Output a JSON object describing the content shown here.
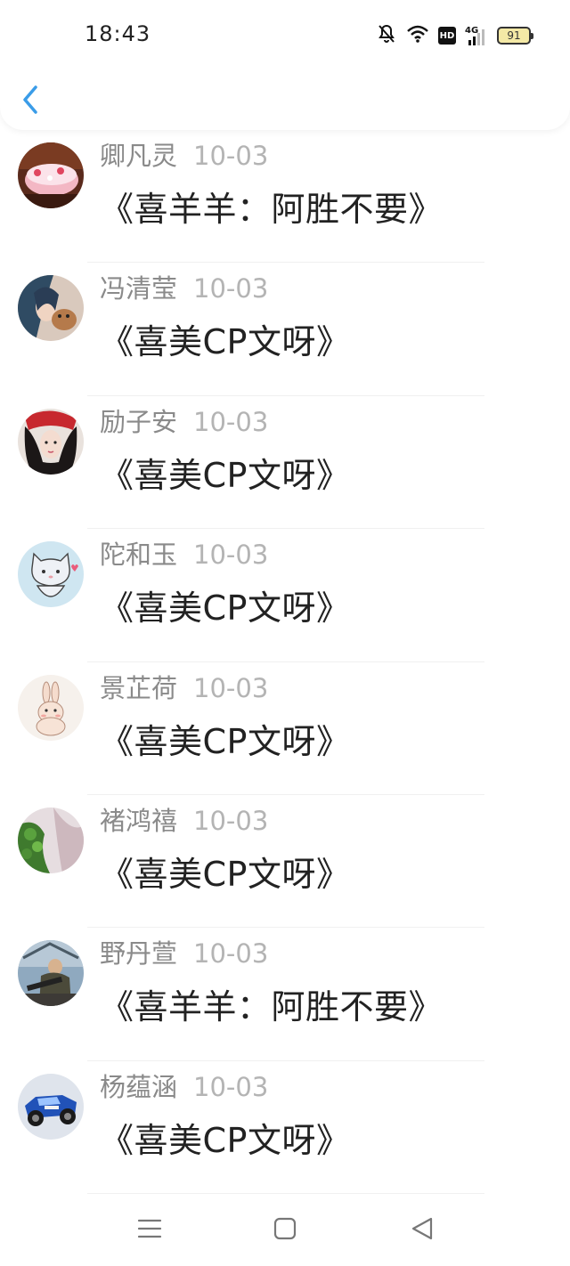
{
  "status_bar": {
    "time": "18:43",
    "battery_level": "91",
    "hd_label": "HD",
    "network_label": "4G",
    "icons": [
      "bell-muted-icon",
      "wifi-icon",
      "hd-icon",
      "signal-4g-icon",
      "battery-icon"
    ]
  },
  "header": {
    "back_icon": "chevron-left-icon",
    "accent_color": "#3a9ce8"
  },
  "comments": [
    {
      "name": "卿凡灵",
      "date": "10-03",
      "message": "《喜羊羊：阿胜不要》"
    },
    {
      "name": "冯清莹",
      "date": "10-03",
      "message": "《喜美CP文呀》"
    },
    {
      "name": "励子安",
      "date": "10-03",
      "message": "《喜美CP文呀》"
    },
    {
      "name": "陀和玉",
      "date": "10-03",
      "message": "《喜美CP文呀》"
    },
    {
      "name": "景芷荷",
      "date": "10-03",
      "message": "《喜美CP文呀》"
    },
    {
      "name": "褚鸿禧",
      "date": "10-03",
      "message": "《喜美CP文呀》"
    },
    {
      "name": "野丹萱",
      "date": "10-03",
      "message": "《喜羊羊：阿胜不要》"
    },
    {
      "name": "杨蕴涵",
      "date": "10-03",
      "message": "《喜美CP文呀》"
    }
  ],
  "nav_bar": {
    "icons": [
      "menu-icon",
      "home-square-icon",
      "back-triangle-icon"
    ]
  }
}
